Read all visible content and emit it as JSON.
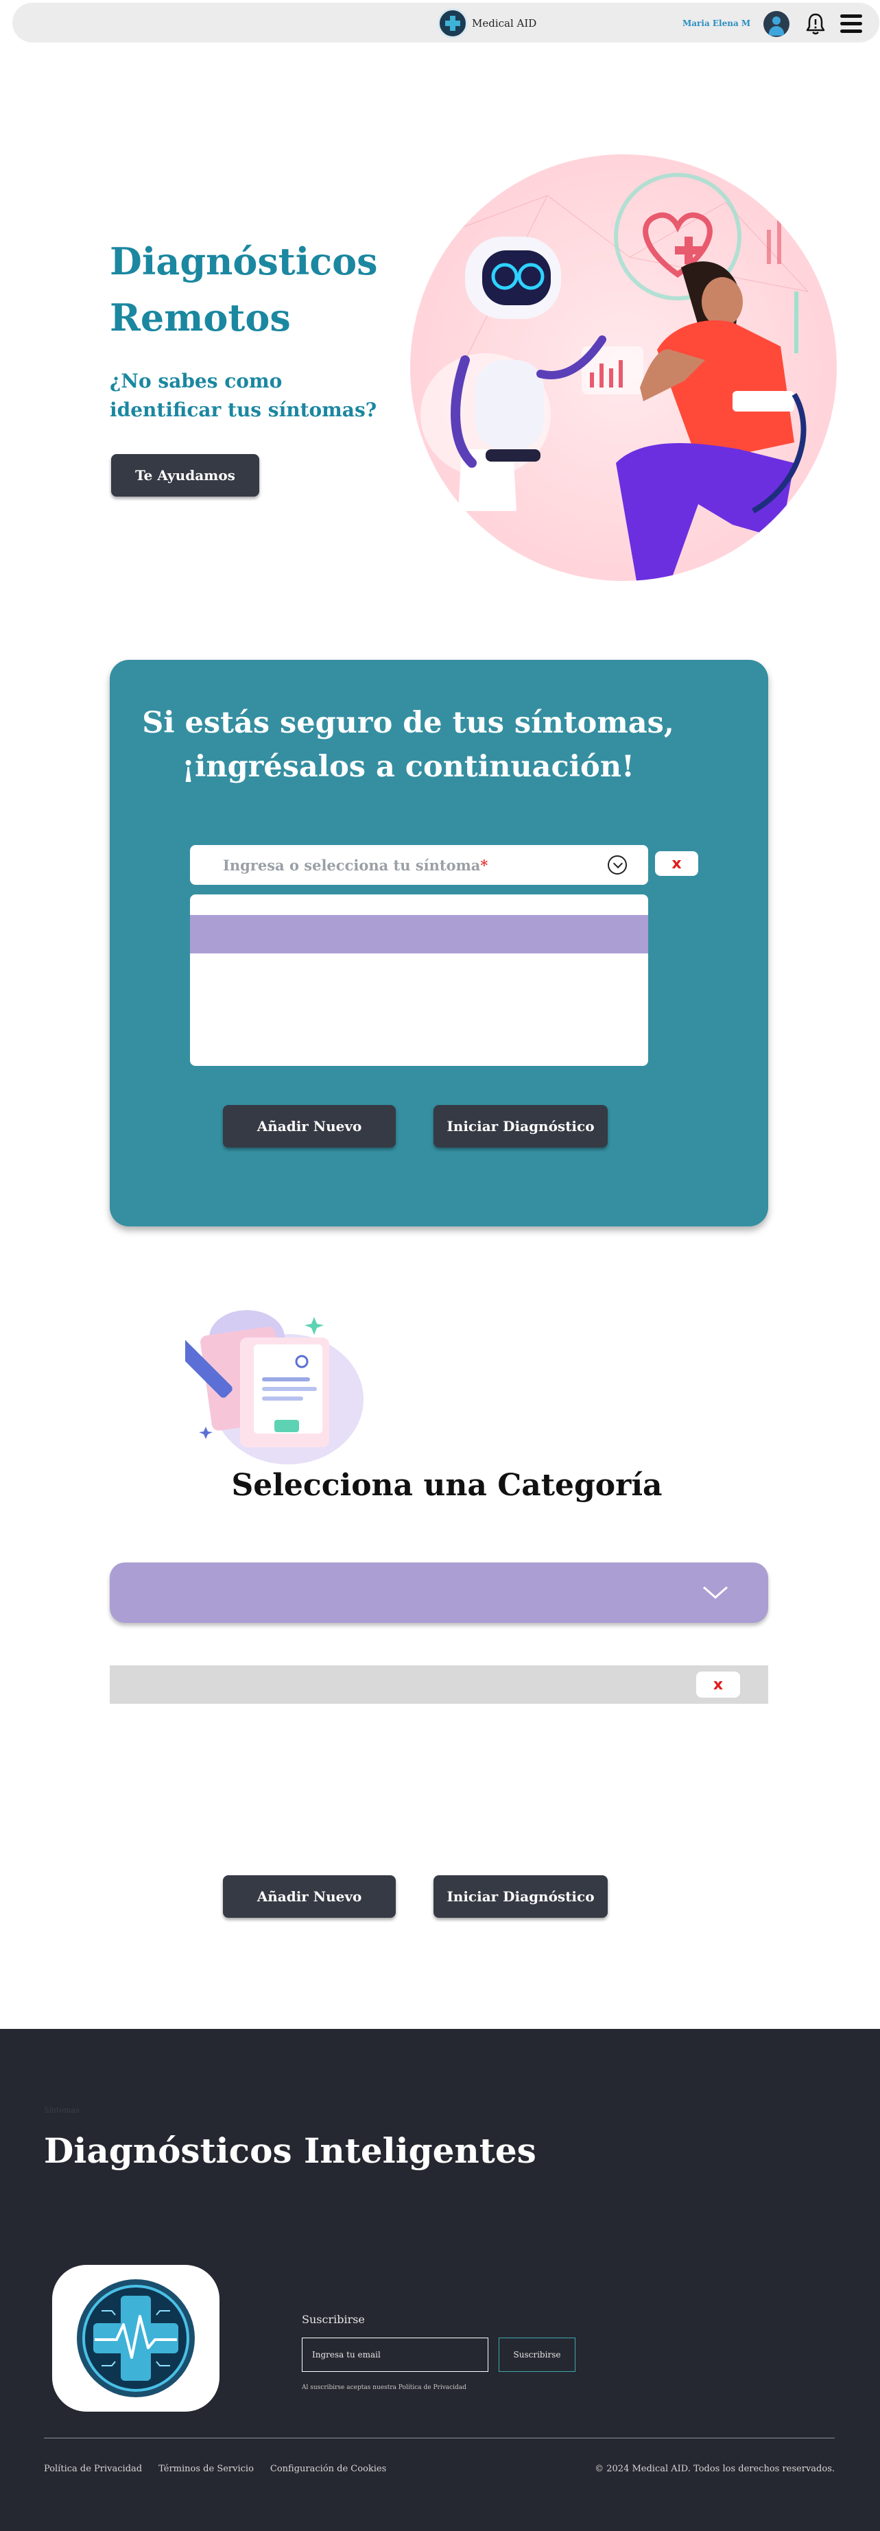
{
  "header": {
    "brand_name": "Medical AID",
    "user_name": "Maria Elena M"
  },
  "hero": {
    "title": "Diagnósticos Remotos",
    "subtitle": "¿No sabes como identificar tus síntomas?",
    "cta_label": "Te Ayudamos"
  },
  "symptoms": {
    "title": "Si estás seguro de tus síntomas, ¡ingrésalos a continuación!",
    "input_placeholder": "Ingresa o selecciona tu síntoma",
    "required_mark": "*",
    "clear_label": "x",
    "add_label": "Añadir Nuevo",
    "start_label": "Iniciar Diagnóstico"
  },
  "category": {
    "title": "Selecciona una Categoría",
    "clear_label": "x",
    "add_label": "Añadir Nuevo",
    "start_label": "Iniciar Diagnóstico"
  },
  "footer": {
    "tiny_text": "Síntomas",
    "title": "Diagnósticos Inteligentes",
    "subscribe_label": "Suscribirse",
    "email_placeholder": "Ingresa tu email",
    "subscribe_button": "Suscribirse",
    "subscribe_note": "Al suscribirse aceptas nuestra Política de Privacidad",
    "links": [
      "Política de Privacidad",
      "Términos de Servicio",
      "Configuración de Cookies"
    ],
    "copyright": "© 2024 Medical AID. Todos los derechos reservados."
  },
  "colors": {
    "teal_accent": "#1b87a0",
    "panel_teal": "#358fa1",
    "lavender": "#ab9ed3",
    "dark_button": "#363a44",
    "footer_bg": "#252830"
  }
}
